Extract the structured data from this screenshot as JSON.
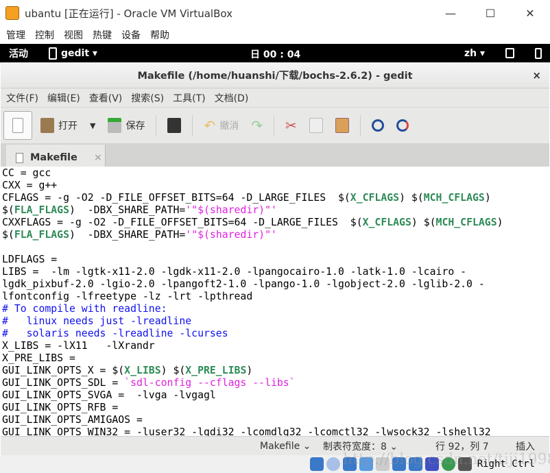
{
  "vbox": {
    "title": "ubantu [正在运行] - Oracle VM VirtualBox",
    "menu": [
      "管理",
      "控制",
      "视图",
      "热键",
      "设备",
      "帮助"
    ],
    "controls": [
      "—",
      "☐",
      "✕"
    ],
    "host_key": "Right Ctrl"
  },
  "topbar": {
    "activities": "活动",
    "app": "gedit ▾",
    "clock": "日 00 : 04",
    "lang": "zh ▾"
  },
  "window": {
    "title": "Makefile (/home/huanshi/下载/bochs-2.6.2) - gedit",
    "close": "×"
  },
  "menu": [
    "文件(F)",
    "编辑(E)",
    "查看(V)",
    "搜索(S)",
    "工具(T)",
    "文档(D)"
  ],
  "toolbar": {
    "open": "打开",
    "save": "保存",
    "undo": "撤消"
  },
  "tab": {
    "label": "Makefile",
    "close": "×"
  },
  "colors": {
    "variable": "#2e8b57",
    "string": "#e020e0",
    "comment": "#1010f0"
  },
  "code": [
    [
      [
        "CC = gcc",
        ""
      ]
    ],
    [
      [
        "CXX = g++",
        ""
      ]
    ],
    [
      [
        "CFLAGS = -g -O2 -D_FILE_OFFSET_BITS=64 -D_LARGE_FILES  $(",
        ""
      ],
      [
        "X_CFLAGS",
        "v"
      ],
      [
        ") $(",
        ""
      ],
      [
        "MCH_CFLAGS",
        "v"
      ],
      [
        ")",
        ""
      ]
    ],
    [
      [
        "$(",
        ""
      ],
      [
        "FLA_FLAGS",
        "v"
      ],
      [
        ")  -DBX_SHARE_PATH=",
        ""
      ],
      [
        "'\"$(sharedir)\"'",
        "s"
      ]
    ],
    [
      [
        "CXXFLAGS = -g -O2 -D_FILE_OFFSET_BITS=64 -D_LARGE_FILES  $(",
        ""
      ],
      [
        "X_CFLAGS",
        "v"
      ],
      [
        ") $(",
        ""
      ],
      [
        "MCH_CFLAGS",
        "v"
      ],
      [
        ")",
        ""
      ]
    ],
    [
      [
        "$(",
        ""
      ],
      [
        "FLA_FLAGS",
        "v"
      ],
      [
        ")  -DBX_SHARE_PATH=",
        ""
      ],
      [
        "'\"$(sharedir)\"'",
        "s"
      ]
    ],
    [
      [
        "",
        ""
      ]
    ],
    [
      [
        "LDFLAGS =",
        ""
      ]
    ],
    [
      [
        "LIBS =  -lm -lgtk-x11-2.0 -lgdk-x11-2.0 -lpangocairo-1.0 -latk-1.0 -lcairo -",
        ""
      ]
    ],
    [
      [
        "lgdk_pixbuf-2.0 -lgio-2.0 -lpangoft2-1.0 -lpango-1.0 -lgobject-2.0 -lglib-2.0 -",
        ""
      ]
    ],
    [
      [
        "lfontconfig -lfreetype -lz -lrt -lpthread",
        ""
      ]
    ],
    [
      [
        "# To compile with readline:",
        "c"
      ]
    ],
    [
      [
        "#   linux needs just -lreadline",
        "c"
      ]
    ],
    [
      [
        "#   solaris needs -lreadline -lcurses",
        "c"
      ]
    ],
    [
      [
        "X_LIBS = -lX11   -lXrandr",
        ""
      ]
    ],
    [
      [
        "X_PRE_LIBS =",
        ""
      ]
    ],
    [
      [
        "GUI_LINK_OPTS_X = $(",
        ""
      ],
      [
        "X_LIBS",
        "v"
      ],
      [
        ") $(",
        ""
      ],
      [
        "X_PRE_LIBS",
        "v"
      ],
      [
        ")",
        ""
      ]
    ],
    [
      [
        "GUI_LINK_OPTS_SDL = ",
        ""
      ],
      [
        "`sdl-config --cflags --libs`",
        "s"
      ]
    ],
    [
      [
        "GUI_LINK_OPTS_SVGA =  -lvga -lvgagl",
        ""
      ]
    ],
    [
      [
        "GUI_LINK_OPTS_RFB =",
        ""
      ]
    ],
    [
      [
        "GUI_LINK_OPTS_AMIGAOS =",
        ""
      ]
    ],
    [
      [
        "GUI_LINK_OPTS_WIN32 = -luser32 -lgdi32 -lcomdlg32 -lcomctl32 -lwsock32 -lshell32",
        ""
      ]
    ]
  ],
  "status": {
    "language": "Makefile ⌄",
    "tab_width": "制表符宽度：8 ⌄",
    "position": "行 92，列 7",
    "mode": "插入"
  },
  "watermark": "http://blog.csdn.net/tiji1998"
}
